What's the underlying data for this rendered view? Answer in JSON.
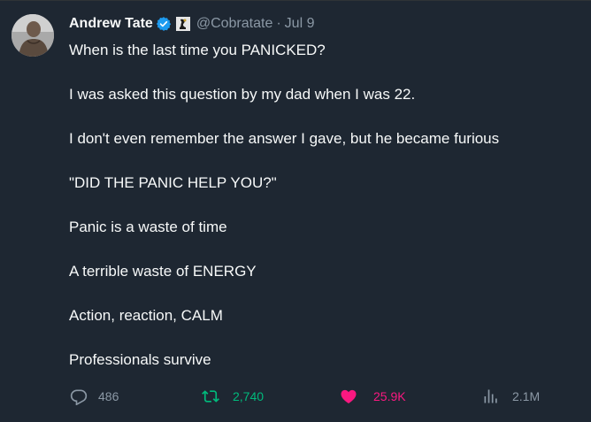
{
  "author": {
    "display_name": "Andrew Tate",
    "handle": "@Cobratate",
    "separator": "·",
    "timestamp": "Jul 9",
    "verified": true,
    "verified_color": "#1d9bf0"
  },
  "tweet": {
    "lines": [
      "When is the last time you PANICKED?",
      "I was asked this question by my dad when I was 22.",
      "I don't even remember the answer I gave, but he became furious",
      "\"DID THE PANIC HELP YOU?\"",
      "Panic is a waste of time",
      "A terrible waste of ENERGY",
      "Action, reaction, CALM",
      "Professionals survive"
    ]
  },
  "actions": {
    "reply": {
      "icon": "reply-icon",
      "count": "486",
      "color": "#8b98a5"
    },
    "retweet": {
      "icon": "retweet-icon",
      "count": "2,740",
      "color": "#00ba7c"
    },
    "like": {
      "icon": "heart-icon",
      "count": "25.9K",
      "color": "#f91880",
      "liked": true
    },
    "views": {
      "icon": "views-icon",
      "count": "2.1M",
      "color": "#8b98a5"
    }
  },
  "colors": {
    "background": "#1e2732",
    "text": "#f7f9f9",
    "muted": "#8b98a5"
  }
}
